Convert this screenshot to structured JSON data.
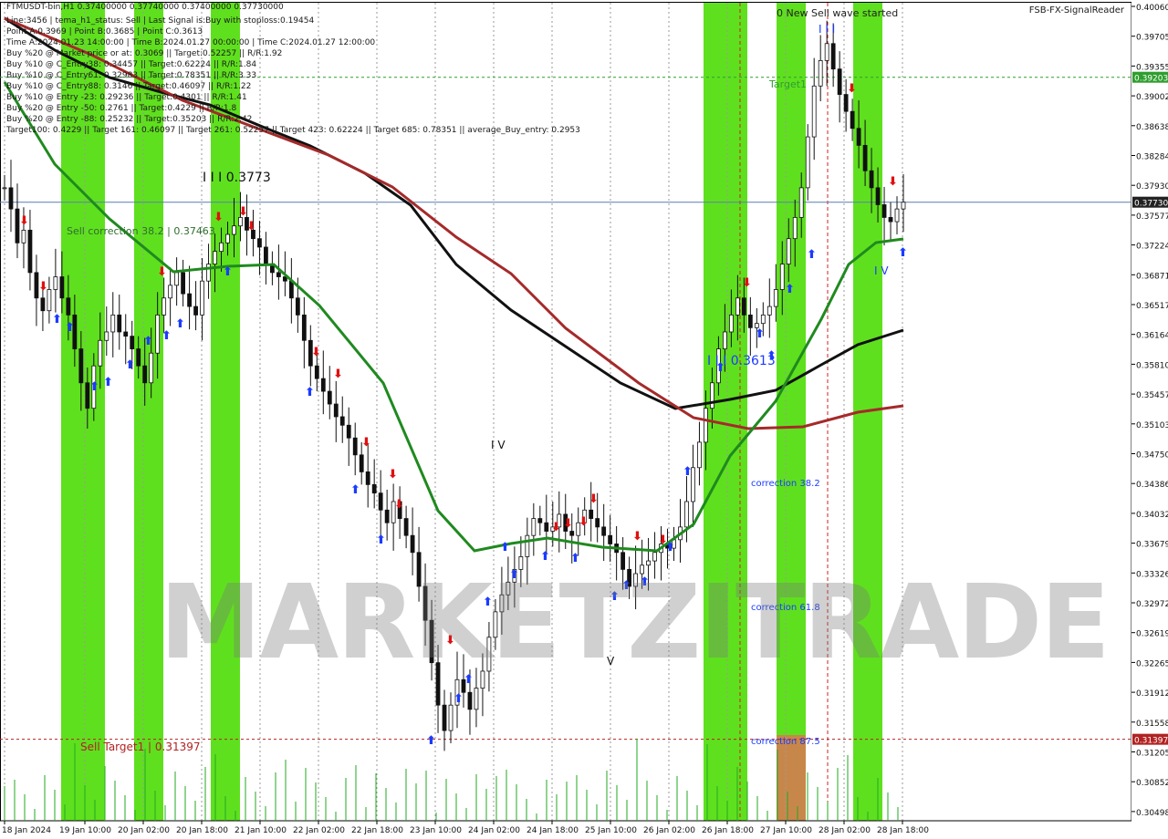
{
  "header": {
    "symbol_line": "FTMUSDT-bin,H1  0.37400000 0.37740000 0.37400000 0.37730000",
    "info_lines": [
      "Line:3456 | tema_h1_status: Sell | Last Signal is:Buy with stoploss:0.19454",
      "Point A:0.3969 | Point B:0.3685 | Point C:0.3613",
      "Time A:2024.01.23 14:00:00 | Time B:2024.01.27 00:00:00 | Time C:2024.01.27 12:00:00",
      "Buy %20 @ Market price or at: 0.3069 || Target:0.52257 || R/R:1.92",
      "Buy %10 @ C_Entry38: 0.34457 || Target:0.62224 || R/R:1.84",
      "Buy %10 @ C_Entry61: 0.32983 || Target:0.78351 || R/R:3.33",
      "Buy %10 @ C_Entry88: 0.3146 || Target:0.46097 || R/R:1.22",
      "Buy %10 @ Entry -23: 0.29236 || Target:0.4301 || R/R:1.41",
      "Buy %20 @ Entry -50: 0.2761 || Target:0.4229 || R/R:1.8",
      "Buy %20 @ Entry -88: 0.25232 || Target:0.35203 || R/R:2.42",
      "Target100: 0.4229 || Target 161: 0.46097 || Target 261: 0.52257 || Target 423: 0.62224 || Target 685: 0.78351 || average_Buy_entry: 0.2953"
    ],
    "indicator_name": "FSB-FX-SignalReader"
  },
  "watermark": "MARKETZITRADE",
  "chart_data": {
    "type": "candlestick",
    "symbol": "FTMUSDT-bin",
    "timeframe": "H1",
    "ylim": [
      0.3049,
      0.4006
    ],
    "y_ticks": [
      "0.40060",
      "0.39705",
      "0.39355",
      "0.39002",
      "0.38638",
      "0.38284",
      "0.37930",
      "0.37577",
      "0.37224",
      "0.36871",
      "0.36517",
      "0.36164",
      "0.35810",
      "0.35457",
      "0.35103",
      "0.34750",
      "0.34386",
      "0.34032",
      "0.33679",
      "0.33326",
      "0.32972",
      "0.32619",
      "0.32265",
      "0.31912",
      "0.31558",
      "0.31205",
      "0.30852",
      "0.30498"
    ],
    "x_ticks": [
      "18 Jan 2024",
      "19 Jan 10:00",
      "20 Jan 02:00",
      "20 Jan 18:00",
      "21 Jan 10:00",
      "22 Jan 02:00",
      "22 Jan 18:00",
      "23 Jan 10:00",
      "24 Jan 02:00",
      "24 Jan 18:00",
      "25 Jan 10:00",
      "26 Jan 02:00",
      "26 Jan 18:00",
      "27 Jan 10:00",
      "28 Jan 02:00",
      "28 Jan 18:00"
    ],
    "current_price": "0.37730",
    "target_price_label": "0.39203",
    "sell_target_price_label": "0.31397",
    "levels": [
      {
        "label": "Target1",
        "price": 0.39203,
        "color": "#2e9e2e"
      },
      {
        "label": "Sell Target1 | 0.31397",
        "price": 0.31397,
        "color": "#b22222"
      }
    ],
    "annotations": [
      "0 New Sell wave started",
      "I I I",
      "I I I 0.3773",
      "Sell correction 38.2 | 0.37463",
      "I V",
      "V",
      "I I I 0.3613",
      "correction 38.2",
      "correction 61.8",
      "correction 87.5"
    ],
    "series": [
      {
        "name": "",
        "color": "#000000"
      },
      {
        "name": "",
        "color": "#a52a2a"
      },
      {
        "name": "",
        "color": "#1f8a1f"
      }
    ],
    "close_path": [
      0.379,
      0.3765,
      0.3725,
      0.374,
      0.369,
      0.366,
      0.3645,
      0.367,
      0.3685,
      0.366,
      0.364,
      0.36,
      0.356,
      0.353,
      0.358,
      0.361,
      0.362,
      0.364,
      0.362,
      0.3615,
      0.36,
      0.358,
      0.356,
      0.3595,
      0.364,
      0.366,
      0.3675,
      0.369,
      0.3665,
      0.365,
      0.364,
      0.368,
      0.37,
      0.3715,
      0.3725,
      0.3735,
      0.3745,
      0.3755,
      0.374,
      0.373,
      0.372,
      0.37,
      0.369,
      0.3685,
      0.368,
      0.366,
      0.364,
      0.361,
      0.358,
      0.3565,
      0.355,
      0.3535,
      0.352,
      0.351,
      0.3495,
      0.3475,
      0.3455,
      0.344,
      0.343,
      0.341,
      0.3395,
      0.342,
      0.34,
      0.338,
      0.336,
      0.332,
      0.328,
      0.323,
      0.318,
      0.315,
      0.318,
      0.321,
      0.3195,
      0.3175,
      0.32,
      0.322,
      0.326,
      0.329,
      0.331,
      0.3325,
      0.334,
      0.3355,
      0.338,
      0.34,
      0.3395,
      0.3385,
      0.339,
      0.3405,
      0.3385,
      0.338,
      0.3395,
      0.341,
      0.34,
      0.339,
      0.338,
      0.337,
      0.336,
      0.334,
      0.332,
      0.3335,
      0.3345,
      0.335,
      0.336,
      0.337,
      0.3365,
      0.3375,
      0.339,
      0.342,
      0.346,
      0.349,
      0.353,
      0.356,
      0.36,
      0.362,
      0.364,
      0.366,
      0.364,
      0.3625,
      0.363,
      0.364,
      0.365,
      0.367,
      0.37,
      0.373,
      0.3755,
      0.379,
      0.385,
      0.391,
      0.394,
      0.396,
      0.393,
      0.39,
      0.388,
      0.386,
      0.384,
      0.381,
      0.379,
      0.377,
      0.3755,
      0.375,
      0.3765,
      0.3773
    ],
    "volume_bars": 90
  }
}
